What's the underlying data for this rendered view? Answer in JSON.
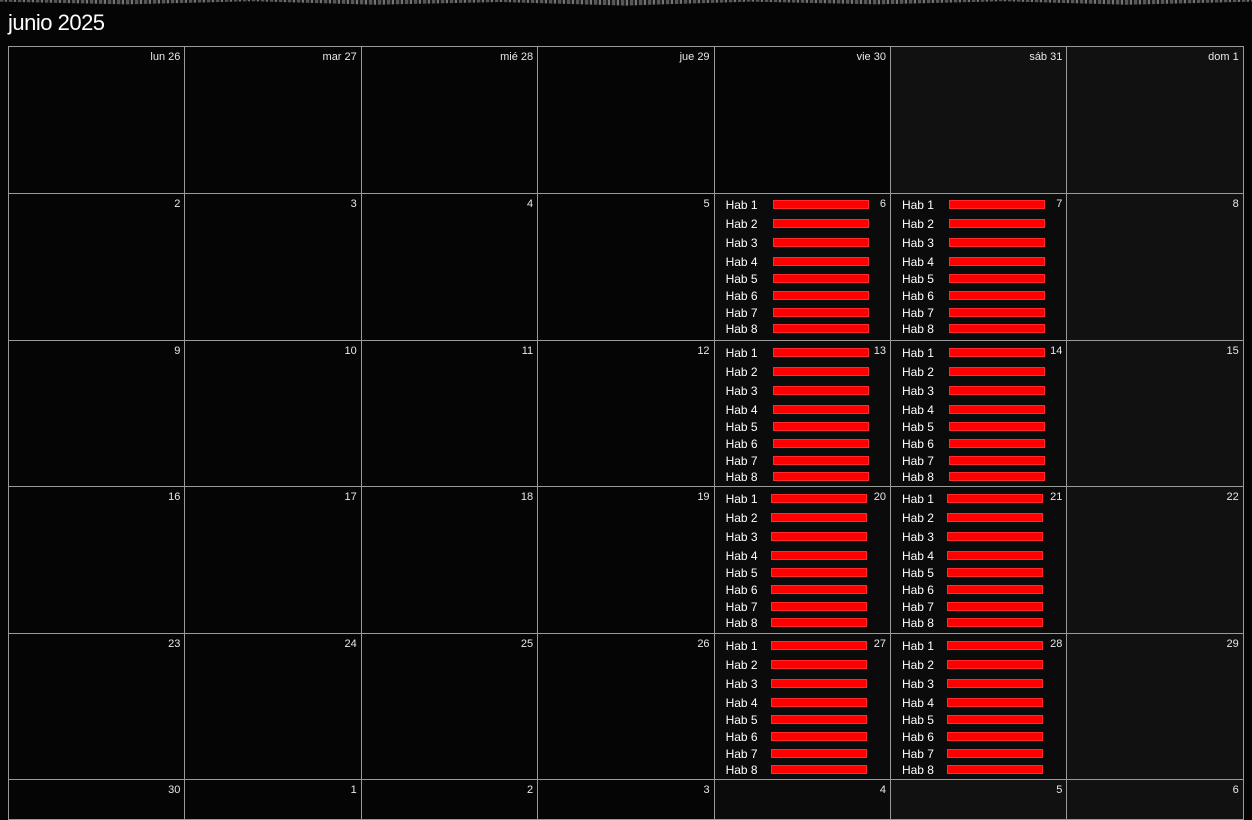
{
  "header": {
    "title": "junio 2025"
  },
  "weekday_headers": [
    "lun 26",
    "mar 27",
    "mié 28",
    "jue 29",
    "vie 30",
    "sáb 31",
    "dom 1"
  ],
  "weeks": [
    [
      "2",
      "3",
      "4",
      "5",
      "6",
      "7",
      "8"
    ],
    [
      "9",
      "10",
      "11",
      "12",
      "13",
      "14",
      "15"
    ],
    [
      "16",
      "17",
      "18",
      "19",
      "20",
      "21",
      "22"
    ],
    [
      "23",
      "24",
      "25",
      "26",
      "27",
      "28",
      "29"
    ],
    [
      "30",
      "1",
      "2",
      "3",
      "4",
      "5",
      "6"
    ]
  ],
  "room_labels": [
    "Hab 1",
    "Hab 2",
    "Hab 3",
    "Hab 4",
    "Hab 5",
    "Hab 6",
    "Hab 7",
    "Hab 8"
  ],
  "colors": {
    "booked": "#ff0000",
    "partial_line": "#7a1a8a",
    "weekend_bg": "#111111"
  }
}
